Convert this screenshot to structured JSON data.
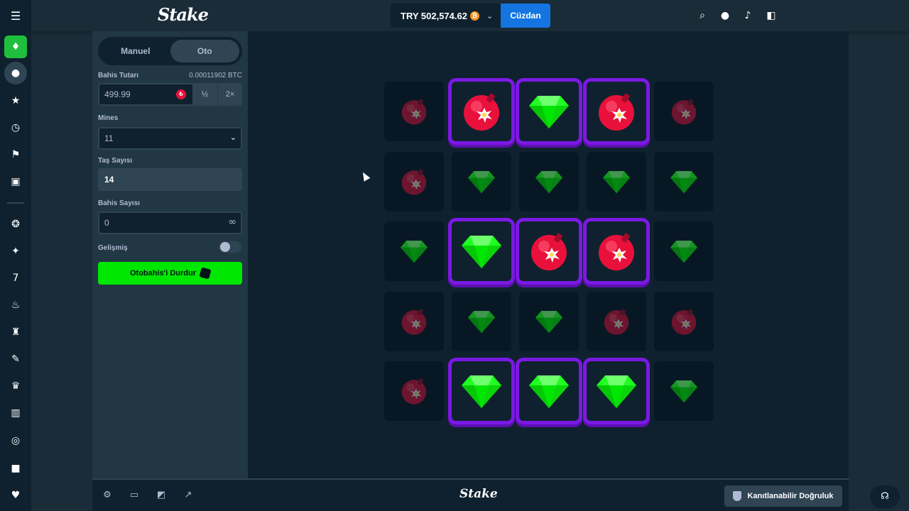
{
  "header": {
    "logo": "Stake",
    "balance": "TRY 502,574.62",
    "wallet_label": "Cüzdan"
  },
  "sidebar_rail": {
    "items": [
      "casino-icon",
      "sports-icon",
      "favourites-icon",
      "recent-icon",
      "challenges-icon",
      "my-bets-icon",
      "originals-icon",
      "new-releases-icon",
      "slots-icon",
      "hot-icon",
      "game-shows-icon",
      "tools-icon",
      "trending-icon",
      "wallet-icon",
      "live-support-icon",
      "promotions-icon",
      "exclusives-icon"
    ]
  },
  "controls": {
    "tabs": [
      {
        "label": "Manuel"
      },
      {
        "label": "Oto"
      }
    ],
    "bet_amount_label": "Bahis Tutarı",
    "bet_amount_crypto": "0.00011902 BTC",
    "bet_amount_value": "499.99",
    "half_label": "½",
    "double_label": "2×",
    "mines_label": "Mines",
    "mines_value": "11",
    "gems_label": "Taş Sayısı",
    "gems_value": "14",
    "bet_count_label": "Bahis Sayısı",
    "bet_count_value": "0",
    "advanced_label": "Gelişmiş",
    "stop_autobet_label": "Otobahis'i Durdur"
  },
  "grid": {
    "rows": [
      [
        "mine-dim",
        "mine-revealed",
        "gem-revealed",
        "mine-revealed",
        "mine-dim"
      ],
      [
        "mine-dim",
        "gem-dim",
        "gem-dim",
        "gem-dim",
        "gem-dim"
      ],
      [
        "gem-dim",
        "gem-revealed",
        "mine-revealed",
        "mine-revealed",
        "gem-dim"
      ],
      [
        "mine-dim",
        "gem-dim",
        "gem-dim",
        "mine-dim",
        "mine-dim"
      ],
      [
        "mine-dim",
        "gem-revealed",
        "gem-revealed",
        "gem-revealed",
        "gem-dim"
      ]
    ]
  },
  "footer": {
    "logo": "Stake",
    "fairness_label": "Kanıtlanabilir Doğruluk"
  },
  "colors": {
    "accent_green": "#00e701",
    "reveal_purple": "#7b19e4",
    "wallet_blue": "#1475e1",
    "mine_red": "#e9113c"
  }
}
